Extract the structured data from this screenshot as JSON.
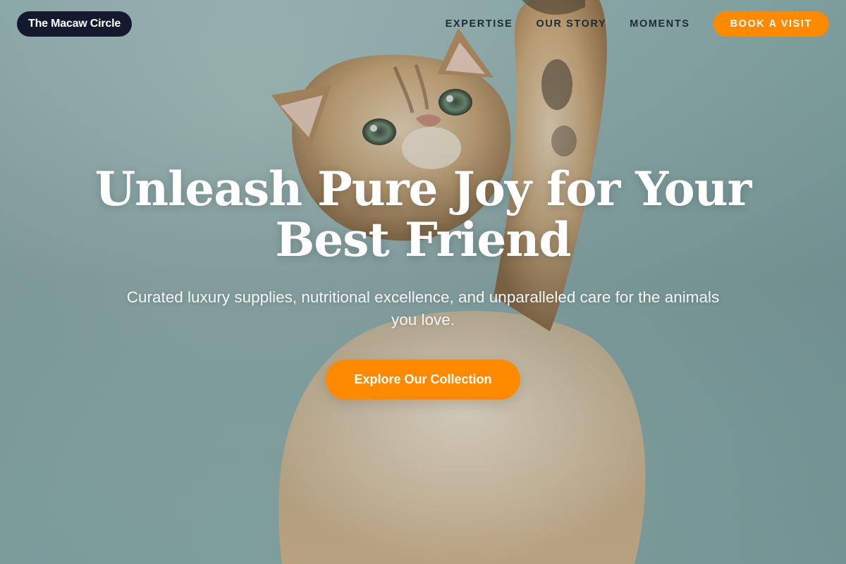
{
  "brand": {
    "name": "The Macaw Circle"
  },
  "nav": {
    "links": [
      "EXPERTISE",
      "OUR STORY",
      "MOMENTS"
    ],
    "cta_label": "BOOK A VISIT"
  },
  "hero": {
    "headline_line1": "Unleash Pure Joy for Your",
    "headline_line2": "Best Friend",
    "subtitle": "Curated luxury supplies, nutritional excellence, and unparalleled care for the animals you love.",
    "cta_label": "Explore Our Collection",
    "image": "kitten-reaching-up-photo"
  },
  "colors": {
    "accent": "#ff8a00",
    "brand_bg": "#141a2e",
    "background": "#93b2b1"
  }
}
